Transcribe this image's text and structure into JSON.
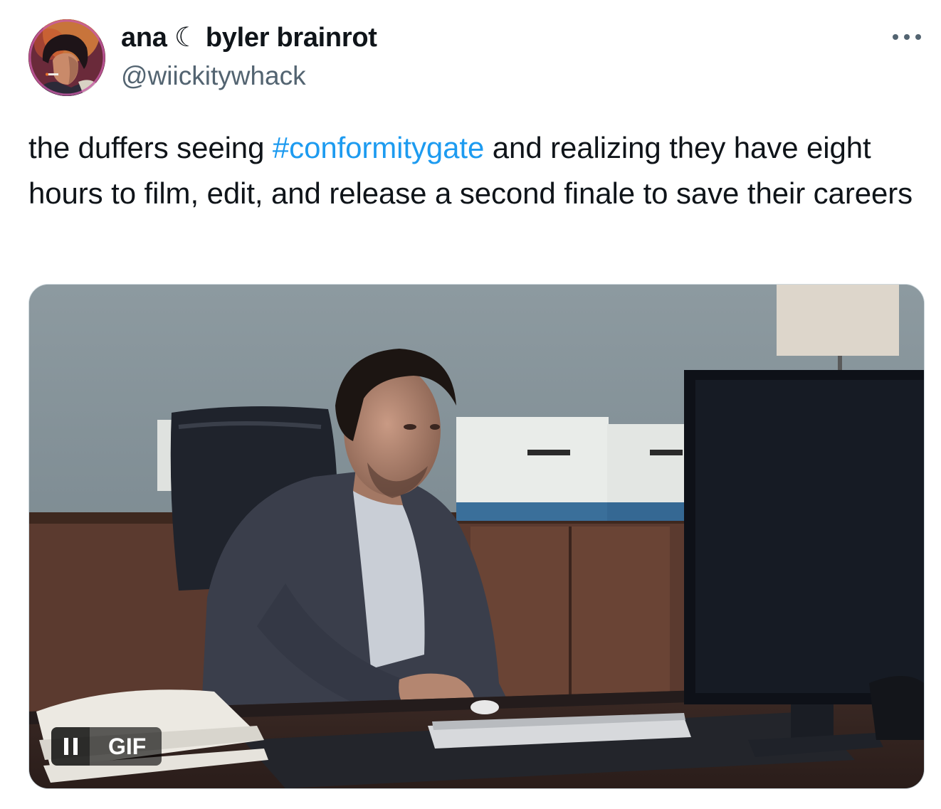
{
  "tweet": {
    "author": {
      "display_name": "ana ☾ byler brainrot",
      "handle": "@wiickitywhack",
      "avatar_icon": "avatar-image"
    },
    "more_icon": "more-options-icon",
    "text": {
      "before_hashtag": "the duffers seeing ",
      "hashtag": "#conformitygate",
      "after_hashtag": " and realizing they have eight hours to film, edit, and release a second finale to save their careers"
    },
    "media": {
      "type": "gif",
      "badge_label": "GIF",
      "pause_icon": "pause-icon"
    },
    "colors": {
      "link": "#1d9bf0",
      "secondary_text": "#536471",
      "primary_text": "#0f1419"
    }
  }
}
